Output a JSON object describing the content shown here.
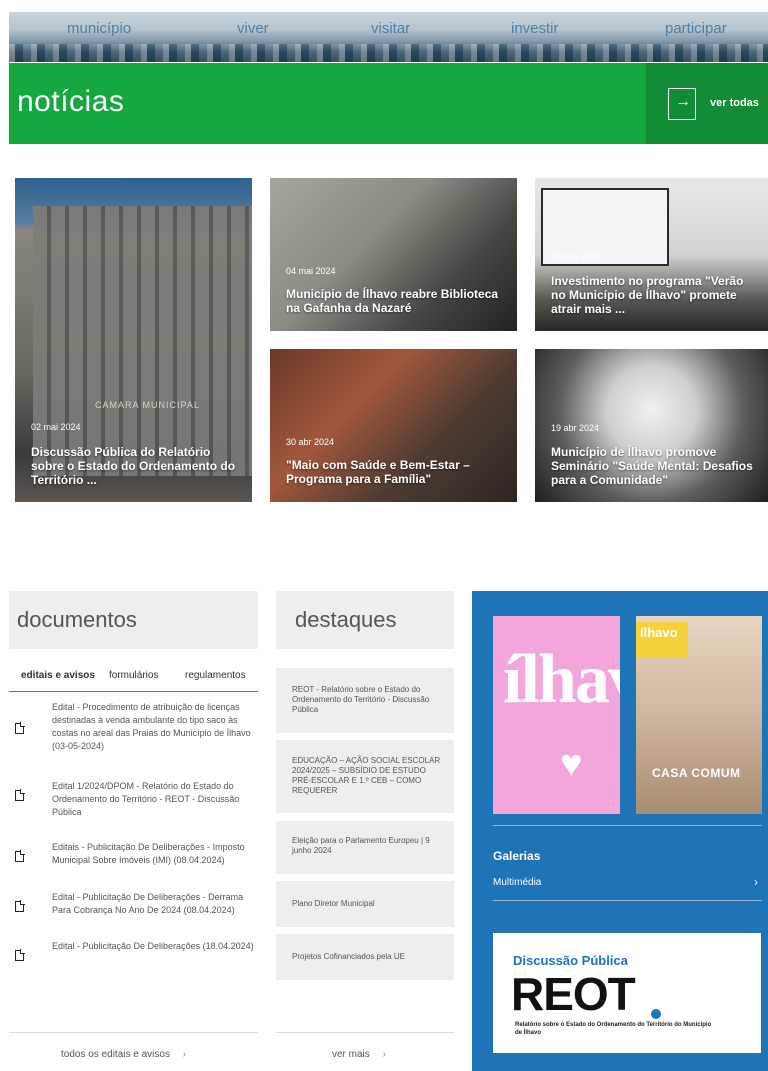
{
  "nav": [
    "município",
    "viver",
    "visitar",
    "investir",
    "participar"
  ],
  "news": {
    "title": "notícias",
    "see_all": "ver todas",
    "cards": [
      {
        "date": "02 mai 2024",
        "title": "Discussão Pública do Relatório sobre o Estado do Ordenamento do Território ..."
      },
      {
        "date": "04 mai 2024",
        "title": "Município de Ílhavo reabre Biblioteca na Gafanha da Nazaré"
      },
      {
        "date": "03 mai 2024",
        "title": "Investimento no programa \"Verão no Município de Ílhavo\" promete atrair mais ..."
      },
      {
        "date": "30 abr 2024",
        "title": "\"Maio com Saúde e Bem-Estar – Programa para a Família\""
      },
      {
        "date": "19 abr 2024",
        "title": "Município de Ílhavo promove Seminário \"Saúde Mental: Desafios para a Comunidade\""
      }
    ],
    "card1_sign": "CAMARA MUNICIPAL"
  },
  "documents": {
    "title": "documentos",
    "tabs": [
      "editais e avisos",
      "formulários",
      "regulamentos"
    ],
    "items": [
      "Edital - Procedimento de atribuição de licenças destinadas à venda ambulante do tipo saco às costas no areal das Praias do Município de Ílhavo (03-05-2024)",
      "Edital 1/2024/DPOM - Relatório do Estado do Ordenamento do Território - REOT - Discussão Pública",
      "Editais - Publicitação De Deliberações - Imposto Municipal Sobre Imóveis (IMI) (08.04.2024)",
      "Edital - Publicitação De Deliberações - Derrama Para Cobrança No Ano De 2024 (08.04.2024)",
      "Edital - Publicitação De Deliberações (18.04.2024)"
    ],
    "footer": "todos os editais e avisos"
  },
  "highlights": {
    "title": "destaques",
    "items": [
      "REOT - Relatório sobre o Estado do Ordenamento do Território - Discussão Pública",
      "EDUCAÇÃO – AÇÃO SOCIAL ESCOLAR 2024/2025 – SUBSÍDIO DE ESTUDO PRÉ-ESCOLAR E 1.º CEB – COMO REQUERER",
      "Eleição para o Parlamento Europeu | 9 junho 2024",
      "Plano Diretor Municipal",
      "Projetos Cofinanciados pela UE"
    ],
    "footer": "ver mais"
  },
  "side": {
    "thumb1_word": "ílhavo",
    "thumb2_logo": "ílhavo",
    "thumb2_title": "CASA COMUM",
    "galleries": "Galerias",
    "multimedia": "Multimédia",
    "banner_kicker": "Discussão Pública",
    "banner_word": "REOT",
    "banner_sub": "Relatório sobre o Estado do Ordenamento do Território do Município de Ílhavo"
  }
}
